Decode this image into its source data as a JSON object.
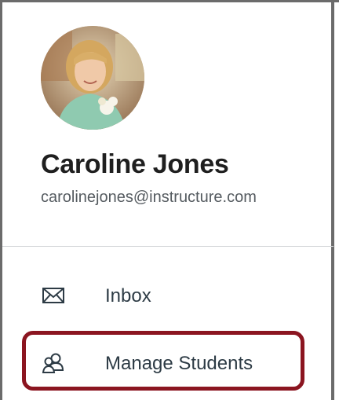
{
  "profile": {
    "name": "Caroline Jones",
    "email": "carolinejones@instructure.com"
  },
  "nav": {
    "items": [
      {
        "label": "Inbox",
        "icon": "envelope-icon"
      },
      {
        "label": "Manage Students",
        "icon": "users-icon"
      }
    ]
  },
  "colors": {
    "highlight": "#8b1520",
    "text": "#2d3b45",
    "divider": "#d4d6d8"
  }
}
